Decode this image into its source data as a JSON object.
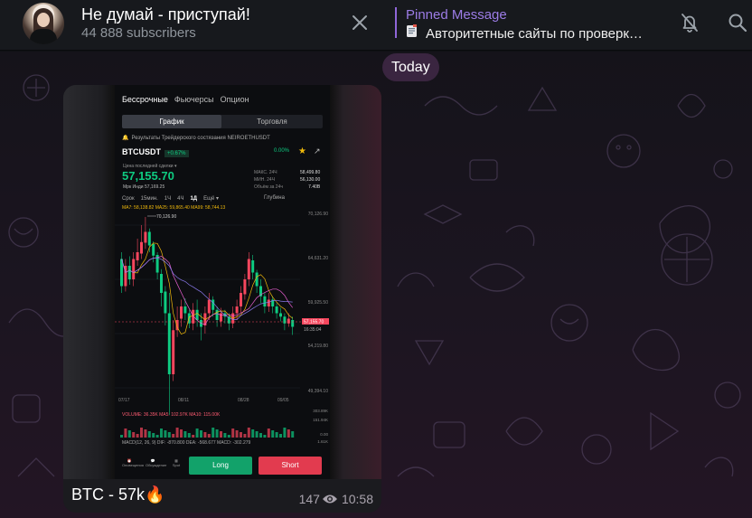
{
  "header": {
    "title": "Не думай - приступай!",
    "subtitle": "44 888 subscribers",
    "pinned_label": "Pinned Message",
    "pinned_text": "Авторитетные сайты по проверк…",
    "pinned_icon": "document-icon",
    "icons": [
      "close-icon",
      "bell-off-icon",
      "search-icon"
    ]
  },
  "chat": {
    "date_pill": "Today",
    "message": {
      "caption": "BTC - 57k🔥",
      "views": "147",
      "time": "10:58",
      "screenshot": {
        "tabs": [
          "Бессрочные",
          "Фьючерсы",
          "Опцион"
        ],
        "segment_on": "График",
        "segment_off": "Торговля",
        "notice": "Результаты Трейдерского состязания NEIROETHUSDT",
        "pair": "BTCUSDT",
        "change_badge": "+0.67%",
        "change_right": "0.00%",
        "price_label": "Цена последней сделки ▾",
        "price": "57,155.70",
        "mark_price": "Мрк Инди 57,169.25",
        "stats_labels": "МАКС. 24Ч\nМИН. 24Ч\nОбъём за 24ч",
        "stats_values": "58,499.80\n56,130.00\n7.40B",
        "timeframes": [
          "Срок",
          "15мин.",
          "1Ч",
          "4Ч",
          "1Д",
          "Ещё ▾"
        ],
        "active_timeframe": "1Д",
        "depth": "Глубина",
        "ma_line": "MA7: 58,138.82  MA25: 59,865.40  MA99: 58,744.13",
        "volume_line": "VOLUME: 36.35K   MA5: 102.97K   MA10: 115.00K",
        "macd_line": "MACD(12, 26, 9)   DIF: -870.800   DEA: -568.677   MACD: -302.279",
        "long_label": "Long",
        "short_label": "Short",
        "bottom_icons": [
          "Оповещения",
          "Обсуждение",
          "Spot"
        ],
        "chart_labels": {
          "high": "70,126.90",
          "low": "49,394.10",
          "last": "57,155.70",
          "last_time": "16:35:04",
          "y_ticks": [
            "70,126.90",
            "64,631.20",
            "59,925.50",
            "54,219.80",
            "49,394.10"
          ],
          "x_ticks": [
            "07/17",
            "08/11",
            "08/28",
            "09/05"
          ],
          "vol_ticks": [
            "303.89K",
            "151.94K",
            "0.00",
            "1.61K"
          ]
        }
      }
    }
  },
  "colors": {
    "accent_purple": "#9c7ce6",
    "candle_up": "#0ecb81",
    "candle_down": "#f6465d",
    "date_pill": "#3a2540"
  }
}
